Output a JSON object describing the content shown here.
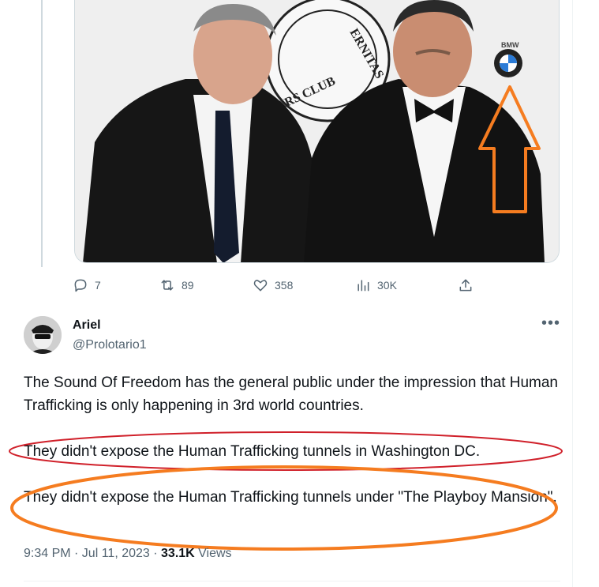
{
  "media": {
    "sign_text_top": "ERNITAS",
    "sign_text_bottom": "ARS CLUB",
    "logo_text": "BMW"
  },
  "actions": {
    "replies": "7",
    "reposts": "89",
    "likes": "358",
    "views": "30K"
  },
  "tweet": {
    "author_name": "Ariel",
    "author_handle": "@Prolotario1",
    "paragraph_1": "The Sound Of Freedom has the general public under the impression that Human Trafficking is only happening in 3rd world countries.",
    "paragraph_2": "They didn't expose the Human Trafficking tunnels in Washington DC.",
    "paragraph_3": "They didn't expose the Human Trafficking tunnels under \"The Playboy Mansion\".",
    "timestamp": "9:34 PM · Jul 11, 2023",
    "separator": " · ",
    "view_count": "33.1K",
    "view_label": " Views"
  },
  "colors": {
    "annotation_red": "#d0202a",
    "annotation_orange": "#f57c20",
    "secondary_text": "#536471"
  },
  "icons": [
    "reply-icon",
    "repost-icon",
    "like-icon",
    "views-icon",
    "share-icon",
    "more-icon"
  ]
}
